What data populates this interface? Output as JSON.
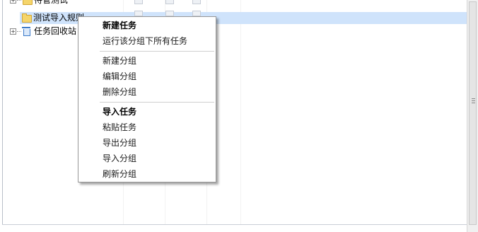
{
  "tree": {
    "rows": [
      {
        "label": "待管测试",
        "icon": "folder-icon",
        "expandable": true
      },
      {
        "label": "测试导入规则",
        "icon": "folder-icon",
        "selected": true
      },
      {
        "label": "任务回收站",
        "icon": "trash-icon",
        "expandable": true
      }
    ]
  },
  "context_menu": {
    "items": [
      {
        "label": "新建任务",
        "bold": true
      },
      {
        "label": "运行该分组下所有任务"
      },
      {
        "separator": true
      },
      {
        "label": "新建分组"
      },
      {
        "label": "编辑分组"
      },
      {
        "label": "删除分组"
      },
      {
        "separator": true
      },
      {
        "label": "导入任务",
        "bold": true
      },
      {
        "label": "粘贴任务"
      },
      {
        "label": "导出分组"
      },
      {
        "label": "导入分组"
      },
      {
        "label": "刷新分组"
      }
    ]
  },
  "colors": {
    "selection": "#cfe3fb",
    "menu_border": "#979797",
    "folder": "#f5d56b"
  }
}
